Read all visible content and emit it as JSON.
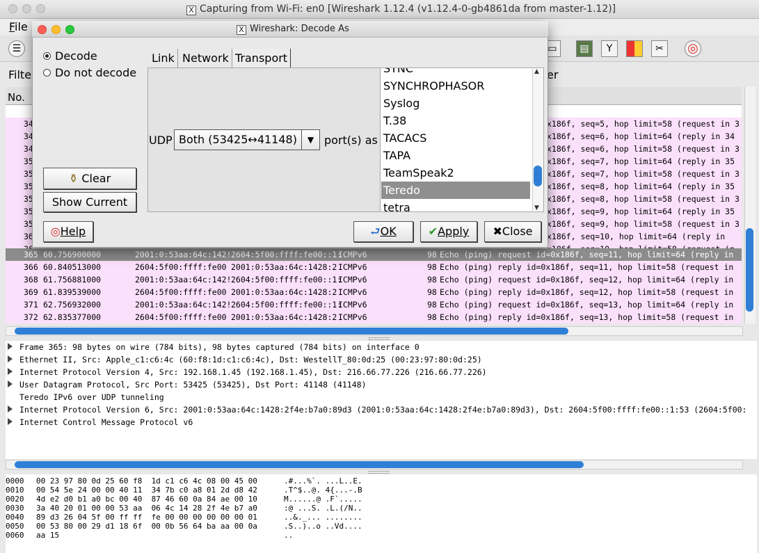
{
  "window": {
    "title": "Capturing from Wi-Fi: en0    [Wireshark 1.12.4  (v1.12.4-0-gb4861da from master-1.12)]",
    "menu_file": "File",
    "filter_label": "Filte",
    "filter_tail": "er",
    "column_no": "No."
  },
  "packets": [
    {
      "no": "365",
      "time": "60.756900000",
      "src": "2001:0:53aa:64c:142!",
      "dst": "2604:5f00:ffff:fe00::1:",
      "proto": "ICMPv6",
      "len": "98",
      "info": "Echo (ping) request id=0x186f, seq=11, hop limit=64 (reply in",
      "selected": true
    },
    {
      "no": "366",
      "time": "60.840513000",
      "src": "2604:5f00:ffff:fe00",
      "dst": "2001:0:53aa:64c:1428:2",
      "proto": "ICMPv6",
      "len": "98",
      "info": "Echo (ping) reply id=0x186f, seq=11, hop limit=58 (request in",
      "selected": false
    },
    {
      "no": "368",
      "time": "61.756881000",
      "src": "2001:0:53aa:64c:142!",
      "dst": "2604:5f00:ffff:fe00::1:",
      "proto": "ICMPv6",
      "len": "98",
      "info": "Echo (ping) request id=0x186f, seq=12, hop limit=64 (reply in",
      "selected": false
    },
    {
      "no": "369",
      "time": "61.839539000",
      "src": "2604:5f00:ffff:fe00",
      "dst": "2001:0:53aa:64c:1428:2",
      "proto": "ICMPv6",
      "len": "98",
      "info": "Echo (ping) reply id=0x186f, seq=12, hop limit=58 (request in",
      "selected": false
    },
    {
      "no": "371",
      "time": "62.756932000",
      "src": "2001:0:53aa:64c:142!",
      "dst": "2604:5f00:ffff:fe00::1:",
      "proto": "ICMPv6",
      "len": "98",
      "info": "Echo (ping) request id=0x186f, seq=13, hop limit=64 (reply in",
      "selected": false
    },
    {
      "no": "372",
      "time": "62.835377000",
      "src": "2604:5f00:ffff:fe00",
      "dst": "2001:0:53aa:64c:1428:2",
      "proto": "ICMPv6",
      "len": "98",
      "info": "Echo (ping) reply id=0x186f, seq=13, hop limit=58 (request in",
      "selected": false
    }
  ],
  "partial_rows": [
    {
      "no": "34",
      "info": "x186f, seq=5, hop limit=58 (request in 3"
    },
    {
      "no": "34",
      "info": "x186f, seq=6, hop limit=64 (reply in 34"
    },
    {
      "no": "34",
      "info": "x186f, seq=6, hop limit=58 (request in 3"
    },
    {
      "no": "35",
      "info": "x186f, seq=7, hop limit=64 (reply in 35"
    },
    {
      "no": "35",
      "info": "x186f, seq=7, hop limit=58 (request in 3"
    },
    {
      "no": "35",
      "info": "x186f, seq=8, hop limit=64 (reply in 35"
    },
    {
      "no": "35",
      "info": "x186f, seq=8, hop limit=58 (request in 3"
    },
    {
      "no": "35",
      "info": "x186f, seq=9, hop limit=64 (reply in 35"
    },
    {
      "no": "35",
      "info": "x186f, seq=9, hop limit=58 (request in 3"
    },
    {
      "no": "36",
      "info": "x186f, seq=10, hop limit=64 (reply in"
    },
    {
      "no": "36",
      "info": "x186f, seq=10, hop limit=58 (request in"
    }
  ],
  "details": [
    {
      "text": "Frame 365: 98 bytes on wire (784 bits), 98 bytes captured (784 bits) on interface 0",
      "expandable": true
    },
    {
      "text": "Ethernet II, Src: Apple_c1:c6:4c (60:f8:1d:c1:c6:4c), Dst: WestellT_80:0d:25 (00:23:97:80:0d:25)",
      "expandable": true
    },
    {
      "text": "Internet Protocol Version 4, Src: 192.168.1.45 (192.168.1.45), Dst: 216.66.77.226 (216.66.77.226)",
      "expandable": true
    },
    {
      "text": "User Datagram Protocol, Src Port: 53425 (53425), Dst Port: 41148 (41148)",
      "expandable": true
    },
    {
      "text": "Teredo IPv6 over UDP tunneling",
      "expandable": false
    },
    {
      "text": "Internet Protocol Version 6, Src: 2001:0:53aa:64c:1428:2f4e:b7a0:89d3 (2001:0:53aa:64c:1428:2f4e:b7a0:89d3), Dst: 2604:5f00:ffff:fe00::1:53 (2604:5f00:",
      "expandable": true
    },
    {
      "text": "Internet Control Message Protocol v6",
      "expandable": true
    }
  ],
  "hex": [
    {
      "off": "0000",
      "bytes": "00 23 97 80 0d 25 60 f8  1d c1 c6 4c 08 00 45 00",
      "ascii": ".#...%`. ...L..E."
    },
    {
      "off": "0010",
      "bytes": "00 54 5e 24 00 00 40 11  34 7b c0 a8 01 2d d8 42",
      "ascii": ".T^$..@. 4{...-.B"
    },
    {
      "off": "0020",
      "bytes": "4d e2 d0 b1 a0 bc 00 40  87 46 60 0a 84 ae 00 10",
      "ascii": "M......@ .F`....."
    },
    {
      "off": "0030",
      "bytes": "3a 40 20 01 00 00 53 aa  06 4c 14 28 2f 4e b7 a0",
      "ascii": ":@ ...S. .L.(/N.."
    },
    {
      "off": "0040",
      "bytes": "89 d3 26 04 5f 00 ff ff  fe 00 00 00 00 00 00 01",
      "ascii": "..&._... ........"
    },
    {
      "off": "0050",
      "bytes": "00 53 80 00 29 d1 18 6f  00 0b 56 64 ba aa 00 0a",
      "ascii": ".S..)..o ..Vd...."
    },
    {
      "off": "0060",
      "bytes": "aa 15",
      "ascii": ".."
    }
  ],
  "dialog": {
    "title": "Wireshark: Decode As",
    "radio_decode": "Decode",
    "radio_do_not_decode": "Do not decode",
    "decode_selected": true,
    "tabs": [
      "Link",
      "Network",
      "Transport"
    ],
    "active_tab": "Transport",
    "udp_label": "UDP",
    "port_select": "Both (53425↔41148)",
    "ports_as_label": "port(s) as",
    "protocols": [
      "SYNC",
      "SYNCHROPHASOR",
      "Syslog",
      "T.38",
      "TACACS",
      "TAPA",
      "TeamSpeak2",
      "Teredo",
      "tetra"
    ],
    "selected_protocol": "Teredo",
    "clear_label": "Clear",
    "show_current_label": "Show Current",
    "help_label": "Help",
    "ok_label": "OK",
    "apply_label": "Apply",
    "close_label": "Close"
  },
  "colors": {
    "row_pink": "#fbe0fb",
    "selection": "#8c8c8c",
    "scroll_accent": "#2f7fd6"
  }
}
